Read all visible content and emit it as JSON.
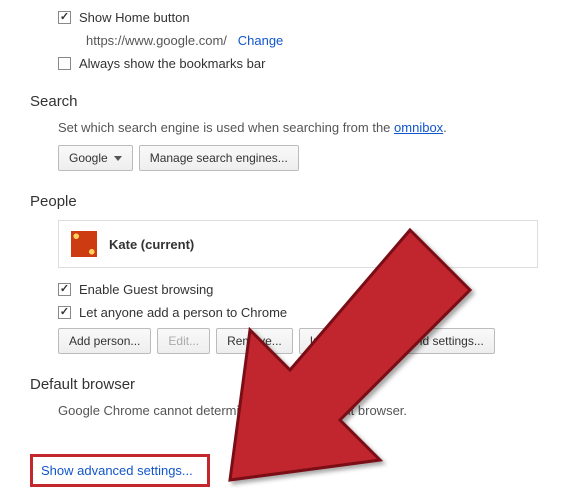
{
  "appearance": {
    "show_home_label": "Show Home button",
    "home_url": "https://www.google.com/",
    "change_link": "Change",
    "bookmarks_bar_label": "Always show the bookmarks bar"
  },
  "search": {
    "title": "Search",
    "desc_prefix": "Set which search engine is used when searching from the ",
    "omnibox_link": "omnibox",
    "desc_suffix": ".",
    "engine_selected": "Google",
    "manage_label": "Manage search engines..."
  },
  "people": {
    "title": "People",
    "profile_name": "Kate (current)",
    "enable_guest_label": "Enable Guest browsing",
    "let_anyone_label": "Let anyone add a person to Chrome",
    "add_person_label": "Add person...",
    "edit_label": "Edit...",
    "remove_label": "Remove...",
    "import_label": "Import bookmarks and settings..."
  },
  "default_browser": {
    "title": "Default browser",
    "status": "Google Chrome cannot determine or set the default browser."
  },
  "advanced": {
    "show_label": "Show advanced settings..."
  }
}
